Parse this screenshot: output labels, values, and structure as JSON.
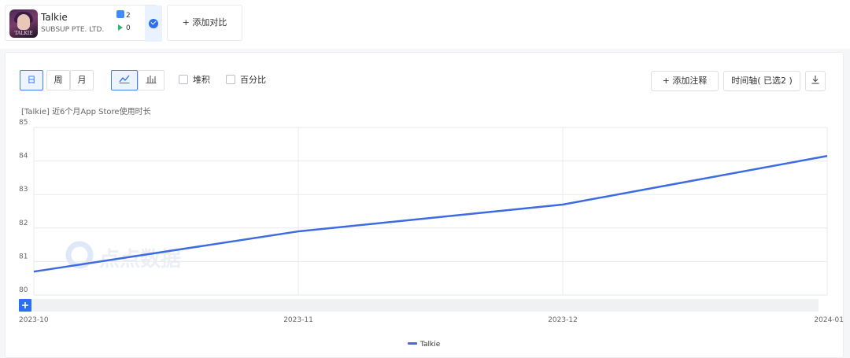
{
  "app": {
    "name": "Talkie",
    "company": "SUBSUP PTE. LTD.",
    "icon_text": "TALKIE",
    "ios_count": "2",
    "android_count": "0",
    "add_compare": "+ 添加对比"
  },
  "toolbar": {
    "day": "日",
    "week": "周",
    "month": "月",
    "stacked": "堆积",
    "percent": "百分比",
    "add_note": "+ 添加注释",
    "timeline": "时间轴( 已选2 )"
  },
  "watermark": "点点数据",
  "chart_data": {
    "type": "line",
    "title": "[Talkie]  近6个月App Store使用时长",
    "x": [
      "2023-10",
      "2023-11",
      "2023-12",
      "2024-01"
    ],
    "ylim": [
      80,
      85
    ],
    "yticks": [
      "80",
      "81",
      "82",
      "83",
      "84",
      "85"
    ],
    "series": [
      {
        "name": "Talkie",
        "color": "#3d6be0",
        "values": [
          80.7,
          81.9,
          82.7,
          84.15
        ]
      }
    ],
    "grid": true,
    "legend": "bottom-center"
  }
}
